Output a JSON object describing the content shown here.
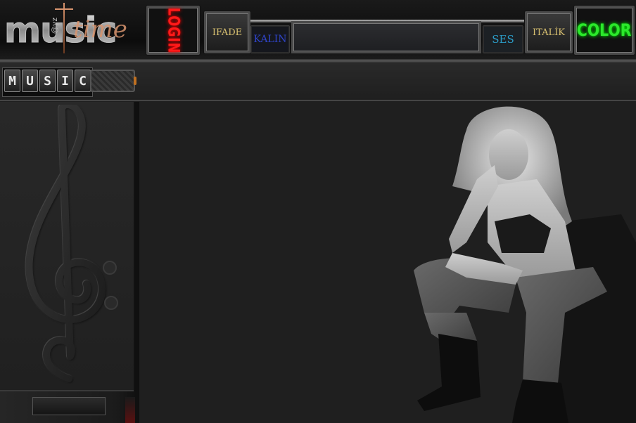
{
  "logo": {
    "brand": "music",
    "script": "time",
    "credit": "@yz"
  },
  "toolbar": {
    "login_label": "LOGIN",
    "ifade_label": "IFADE",
    "kalin_label": "KALIN",
    "ses_label": "SES",
    "italik_label": "ITALİK",
    "color_label": "COLOR",
    "message_value": ""
  },
  "submenu": {
    "music_letters": [
      "M",
      "U",
      "S",
      "I",
      "C"
    ]
  },
  "colors": {
    "login": "#ff1a1a",
    "color_button": "#2ce82c",
    "ifade_text": "#d8c070",
    "kalin_text": "#2f44c8",
    "ses_text": "#2b9dc8",
    "logo_script": "#d9956f"
  },
  "icons": {
    "clef": "treble-bass-clef-icon",
    "figure": "woman-photo"
  }
}
